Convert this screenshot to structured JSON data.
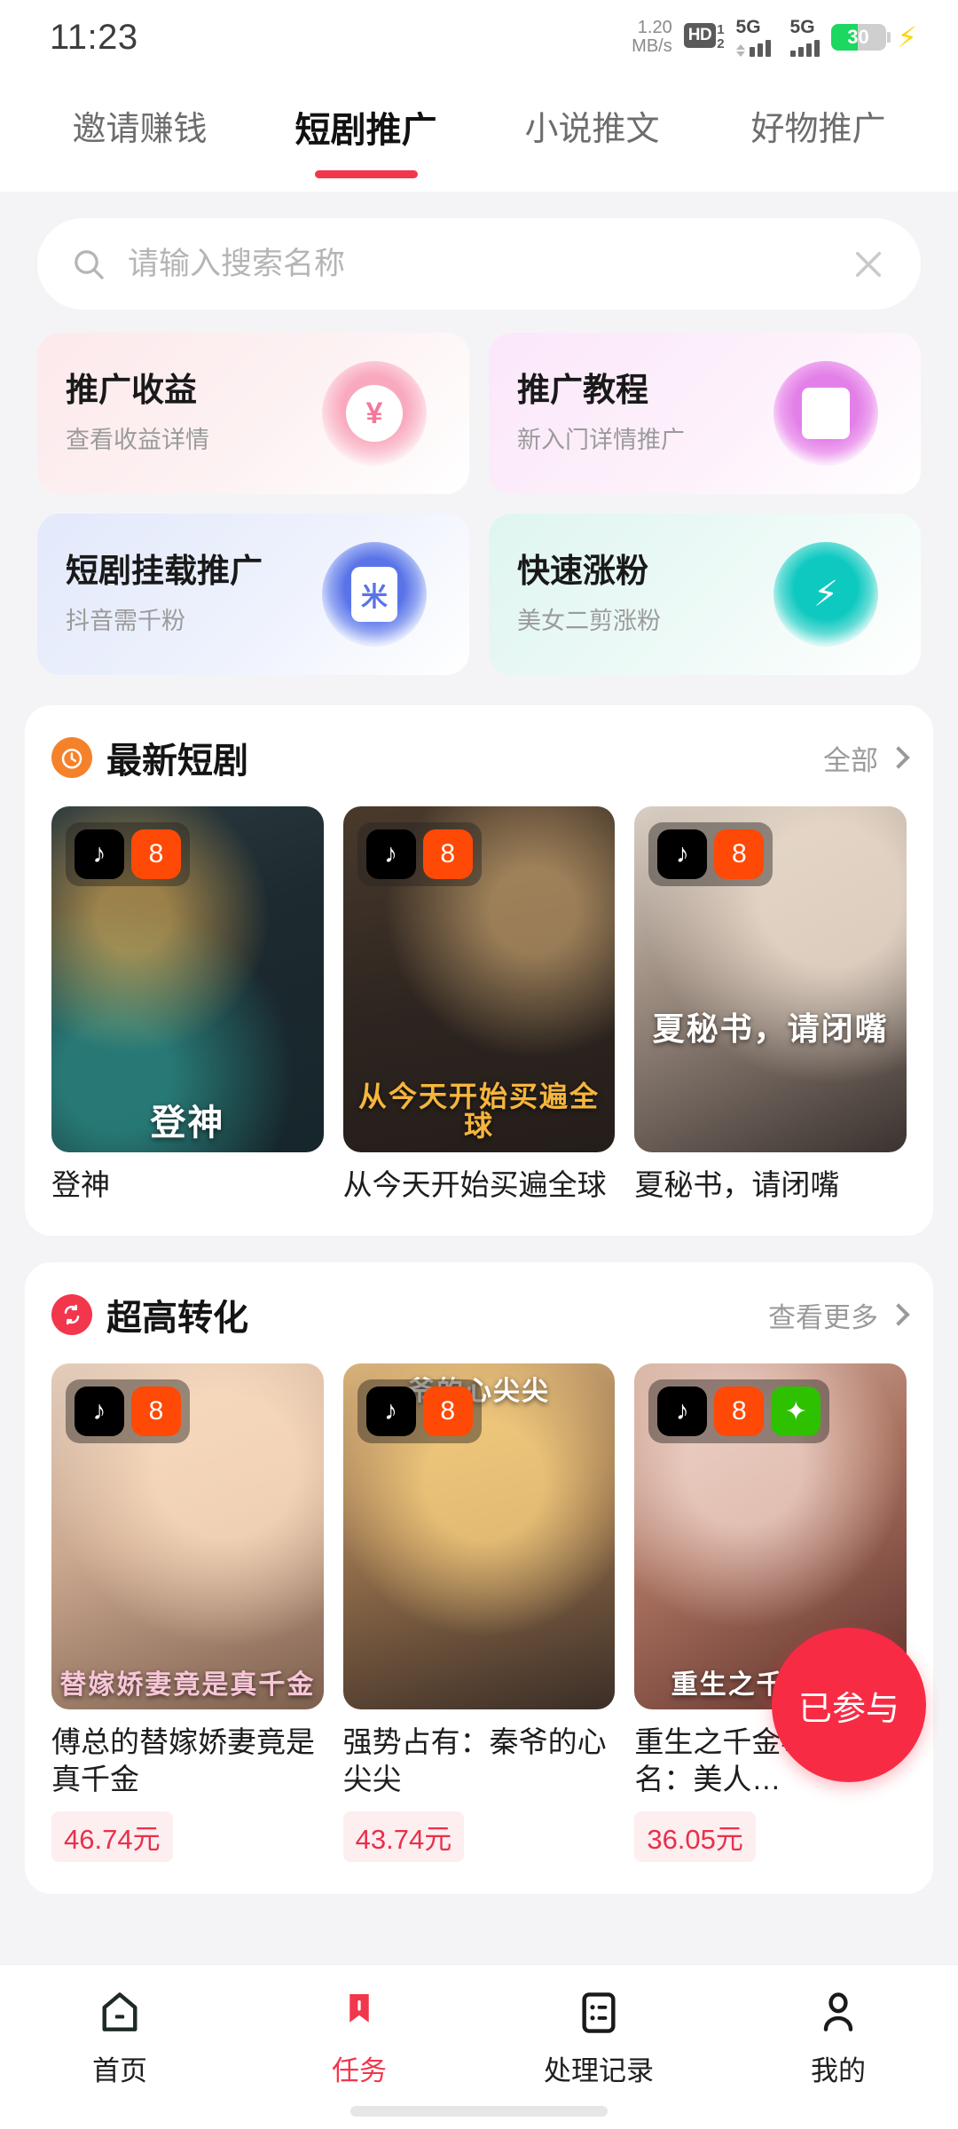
{
  "status_bar": {
    "time": "11:23",
    "net_speed_value": "1.20",
    "net_speed_unit": "MB/s",
    "hd_label": "HD",
    "hd_sup": "1",
    "hd_sub": "2",
    "sim1_network": "5G",
    "sim2_network": "5G",
    "battery_percent": "30",
    "charging_icon": "lightning-bolt-icon",
    "battery_color": "#1cd760"
  },
  "top_tabs": {
    "items": [
      {
        "label": "邀请赚钱",
        "active": false
      },
      {
        "label": "短剧推广",
        "active": true
      },
      {
        "label": "小说推文",
        "active": false
      },
      {
        "label": "好物推广",
        "active": false
      }
    ],
    "active_indicator_color": "#f2364c"
  },
  "search": {
    "placeholder": "请输入搜索名称",
    "value": "",
    "search_icon": "search-icon",
    "clear_icon": "close-x-icon"
  },
  "feature_cards": [
    {
      "title": "推广收益",
      "subtitle": "查看收益详情",
      "icon": "yuan-currency-icon",
      "glyph": "¥",
      "color": "#f48aa5"
    },
    {
      "title": "推广教程",
      "subtitle": "新入门详情推广",
      "icon": "book-icon",
      "glyph": "▢",
      "color": "#e07ee6"
    },
    {
      "title": "短剧挂载推广",
      "subtitle": "抖音需千粉",
      "icon": "douyin-mount-icon",
      "glyph": "米",
      "color": "#5a74e8"
    },
    {
      "title": "快速涨粉",
      "subtitle": "美女二剪涨粉",
      "icon": "fans-growth-icon",
      "glyph": "⚡",
      "color": "#0ec9c0"
    }
  ],
  "sections": [
    {
      "title": "最新短剧",
      "icon": "alarm-clock-icon",
      "icon_color": "#f5822a",
      "more_label": "全部",
      "items": [
        {
          "name": "登神",
          "poster_title": "登神",
          "platforms": [
            "douyin",
            "kuaishou"
          ],
          "price": ""
        },
        {
          "name": "从今天开始买遍全球",
          "poster_title": "从今天开始买遍全球",
          "platforms": [
            "douyin",
            "kuaishou"
          ],
          "price": ""
        },
        {
          "name": "夏秘书，请闭嘴",
          "poster_title": "夏秘书，请闭嘴",
          "platforms": [
            "douyin",
            "kuaishou"
          ],
          "price": ""
        }
      ]
    },
    {
      "title": "超高转化",
      "icon": "conversion-refresh-icon",
      "icon_color": "#f2364c",
      "more_label": "查看更多",
      "items": [
        {
          "name": "傅总的替嫁娇妻竟是真千金",
          "poster_title": "替嫁娇妻竟是真千金",
          "platforms": [
            "douyin",
            "kuaishou"
          ],
          "price": "46.74元"
        },
        {
          "name": "强势占有：秦爷的心尖尖",
          "poster_title": "爷的心尖尖",
          "platforms": [
            "douyin",
            "kuaishou"
          ],
          "price": "43.74元"
        },
        {
          "name": "重生之千金毒妃（又名：美人…",
          "poster_title": "重生之千金毒妃",
          "platforms": [
            "douyin",
            "kuaishou",
            "wechat"
          ],
          "price": "36.05元"
        }
      ]
    }
  ],
  "floating_button": {
    "label": "已参与",
    "color": "#f72c44"
  },
  "bottom_nav": {
    "items": [
      {
        "label": "首页",
        "icon": "home-icon",
        "active": false
      },
      {
        "label": "任务",
        "icon": "task-bookmark-icon",
        "active": true
      },
      {
        "label": "处理记录",
        "icon": "records-list-icon",
        "active": false
      },
      {
        "label": "我的",
        "icon": "user-profile-icon",
        "active": false
      }
    ],
    "active_color": "#f2364c"
  },
  "platform_glyphs": {
    "douyin": "♪",
    "kuaishou": "8",
    "wechat": "💬"
  }
}
